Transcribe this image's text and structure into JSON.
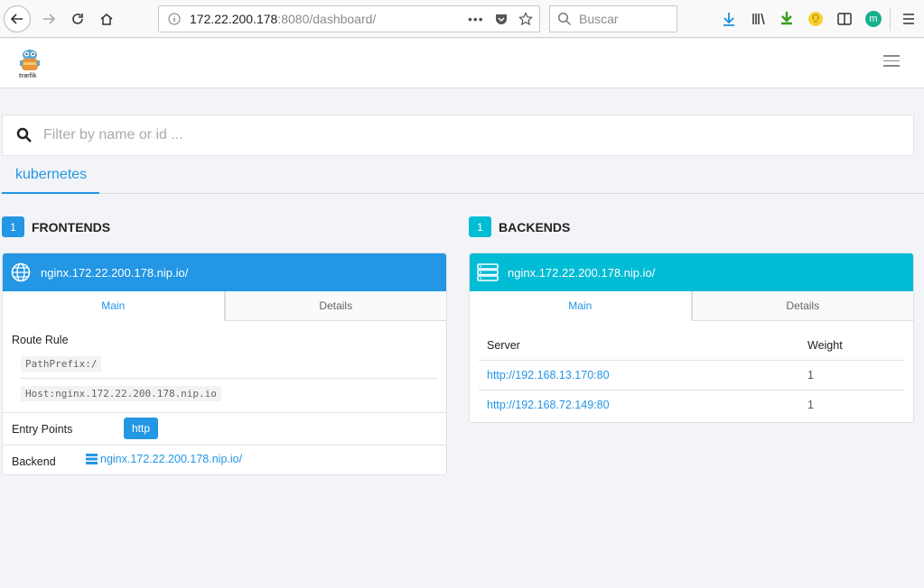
{
  "browser": {
    "url_host": "172.22.200.178",
    "url_rest": ":8080/dashboard/",
    "search_placeholder": "Buscar",
    "avatar_letter": "m"
  },
  "app": {
    "logo_text": "træfik",
    "filter_placeholder": "Filter by name or id ...",
    "provider_tab": "kubernetes"
  },
  "frontends": {
    "count": "1",
    "title": "FRONTENDS",
    "card": {
      "name": "nginx.172.22.200.178.nip.io/",
      "tab_main": "Main",
      "tab_details": "Details",
      "route_rule_label": "Route Rule",
      "rules": [
        "PathPrefix:/",
        "Host:nginx.172.22.200.178.nip.io"
      ],
      "entry_points_label": "Entry Points",
      "entry_point": "http",
      "backend_label": "Backend",
      "backend_link": "nginx.172.22.200.178.nip.io/"
    }
  },
  "backends": {
    "count": "1",
    "title": "BACKENDS",
    "card": {
      "name": "nginx.172.22.200.178.nip.io/",
      "tab_main": "Main",
      "tab_details": "Details",
      "col_server": "Server",
      "col_weight": "Weight",
      "servers": [
        {
          "url": "http://192.168.13.170:80",
          "weight": "1"
        },
        {
          "url": "http://192.168.72.149:80",
          "weight": "1"
        }
      ]
    }
  },
  "colors": {
    "frontend_accent": "#2396e4",
    "backend_accent": "#00bcd4"
  }
}
